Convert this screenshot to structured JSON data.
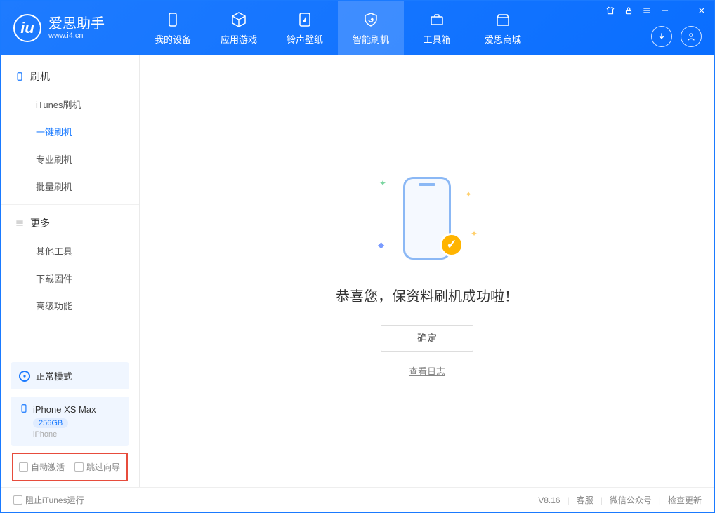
{
  "app": {
    "name": "爱思助手",
    "domain": "www.i4.cn"
  },
  "nav": {
    "tabs": [
      {
        "label": "我的设备"
      },
      {
        "label": "应用游戏"
      },
      {
        "label": "铃声壁纸"
      },
      {
        "label": "智能刷机"
      },
      {
        "label": "工具箱"
      },
      {
        "label": "爱思商城"
      }
    ],
    "activeIndex": 3
  },
  "sidebar": {
    "sections": [
      {
        "label": "刷机",
        "items": [
          {
            "label": "iTunes刷机"
          },
          {
            "label": "一键刷机",
            "active": true
          },
          {
            "label": "专业刷机"
          },
          {
            "label": "批量刷机"
          }
        ]
      },
      {
        "label": "更多",
        "items": [
          {
            "label": "其他工具"
          },
          {
            "label": "下载固件"
          },
          {
            "label": "高级功能"
          }
        ]
      }
    ],
    "status": {
      "label": "正常模式"
    },
    "device": {
      "name": "iPhone XS Max",
      "storage": "256GB",
      "type": "iPhone"
    },
    "checkboxes": {
      "autoActivate": "自动激活",
      "skipGuide": "跳过向导"
    }
  },
  "main": {
    "title": "恭喜您，保资料刷机成功啦！",
    "okButton": "确定",
    "viewLog": "查看日志"
  },
  "footer": {
    "blockItunes": "阻止iTunes运行",
    "version": "V8.16",
    "links": {
      "service": "客服",
      "wechat": "微信公众号",
      "update": "检查更新"
    }
  }
}
